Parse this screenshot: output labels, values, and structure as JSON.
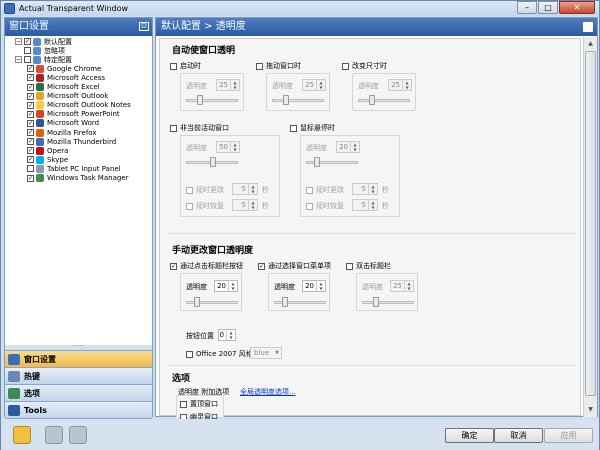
{
  "window": {
    "title": "Actual Transparent Window"
  },
  "left_panel": {
    "header": "窗口设置",
    "tree": [
      {
        "label": "默认配置",
        "checked": true,
        "level": 1,
        "expander": "−"
      },
      {
        "label": "忽略项",
        "checked": false,
        "level": 1,
        "expander": ""
      },
      {
        "label": "特定配置",
        "checked": false,
        "level": 1,
        "expander": "−"
      },
      {
        "label": "Google Chrome",
        "checked": true,
        "level": 2,
        "icon_color": "#e04a2a"
      },
      {
        "label": "Microsoft Access",
        "checked": true,
        "level": 2,
        "icon_color": "#a4262c"
      },
      {
        "label": "Microsoft Excel",
        "checked": true,
        "level": 2,
        "icon_color": "#217346"
      },
      {
        "label": "Microsoft Outlook",
        "checked": true,
        "level": 2,
        "icon_color": "#e8a428"
      },
      {
        "label": "Microsoft Outlook Notes",
        "checked": true,
        "level": 2,
        "icon_color": "#f0d040"
      },
      {
        "label": "Microsoft PowerPoint",
        "checked": true,
        "level": 2,
        "icon_color": "#d24726"
      },
      {
        "label": "Microsoft Word",
        "checked": true,
        "level": 2,
        "icon_color": "#2b579a"
      },
      {
        "label": "Mozilla Firefox",
        "checked": true,
        "level": 2,
        "icon_color": "#e66000"
      },
      {
        "label": "Mozilla Thunderbird",
        "checked": true,
        "level": 2,
        "icon_color": "#3a6ec0"
      },
      {
        "label": "Opera",
        "checked": true,
        "level": 2,
        "icon_color": "#cc0f16"
      },
      {
        "label": "Skype",
        "checked": true,
        "level": 2,
        "icon_color": "#00aff0"
      },
      {
        "label": "Tablet PC Input Panel",
        "checked": false,
        "level": 2,
        "icon_color": "#8a9ab0"
      },
      {
        "label": "Windows Task Manager",
        "checked": true,
        "level": 2,
        "icon_color": "#4a8a4a"
      }
    ],
    "nav": [
      {
        "label": "窗口设置",
        "icon_color": "#3a6fb8",
        "active": true
      },
      {
        "label": "热键",
        "icon_color": "#6a8ab0",
        "active": false
      },
      {
        "label": "选项",
        "icon_color": "#3a8a5a",
        "active": false
      },
      {
        "label": "Tools",
        "icon_color": "#2a5aa0",
        "active": false
      }
    ],
    "more": "»"
  },
  "right_panel": {
    "header": "默认配置 > 透明度",
    "auto": {
      "title": "自动使窗口透明",
      "startup": {
        "label": "启动时",
        "value": "25"
      },
      "drag": {
        "label": "拖动窗口时",
        "value": "25"
      },
      "resize": {
        "label": "改变尺寸时",
        "value": "25"
      },
      "inactive": {
        "label": "非当前活动窗口",
        "value": "50",
        "delay_change": "延时更改",
        "delay_restore": "延时恢复",
        "dv1": "5",
        "dv2": "5",
        "unit": "秒"
      },
      "hover": {
        "label": "鼠标悬停时",
        "value": "20",
        "delay_change": "延时更改",
        "delay_restore": "延时恢复",
        "dv1": "5",
        "dv2": "5",
        "unit": "秒"
      },
      "opacity_label": "透明度"
    },
    "manual": {
      "title": "手动更改窗口透明度",
      "titlebar_btn": {
        "label": "通过点击标题栏按钮",
        "value": "20"
      },
      "menu_item": {
        "label": "通过选择窗口菜单项",
        "value": "20"
      },
      "double_click": {
        "label": "双击标题栏",
        "value": "25"
      },
      "opacity_label": "透明度",
      "button_pos_label": "按钮位置",
      "button_pos_value": "0",
      "office_style_label": "Office 2007 风格",
      "office_style_value": "blue"
    },
    "options": {
      "title": "选项",
      "sub_label": "透明度 附加选项",
      "link": "全局透明度选项...",
      "topmost": "置顶窗口",
      "ghost": "幽灵窗口"
    }
  },
  "footer": {
    "ok": "确定",
    "cancel": "取消",
    "apply": "应用"
  }
}
